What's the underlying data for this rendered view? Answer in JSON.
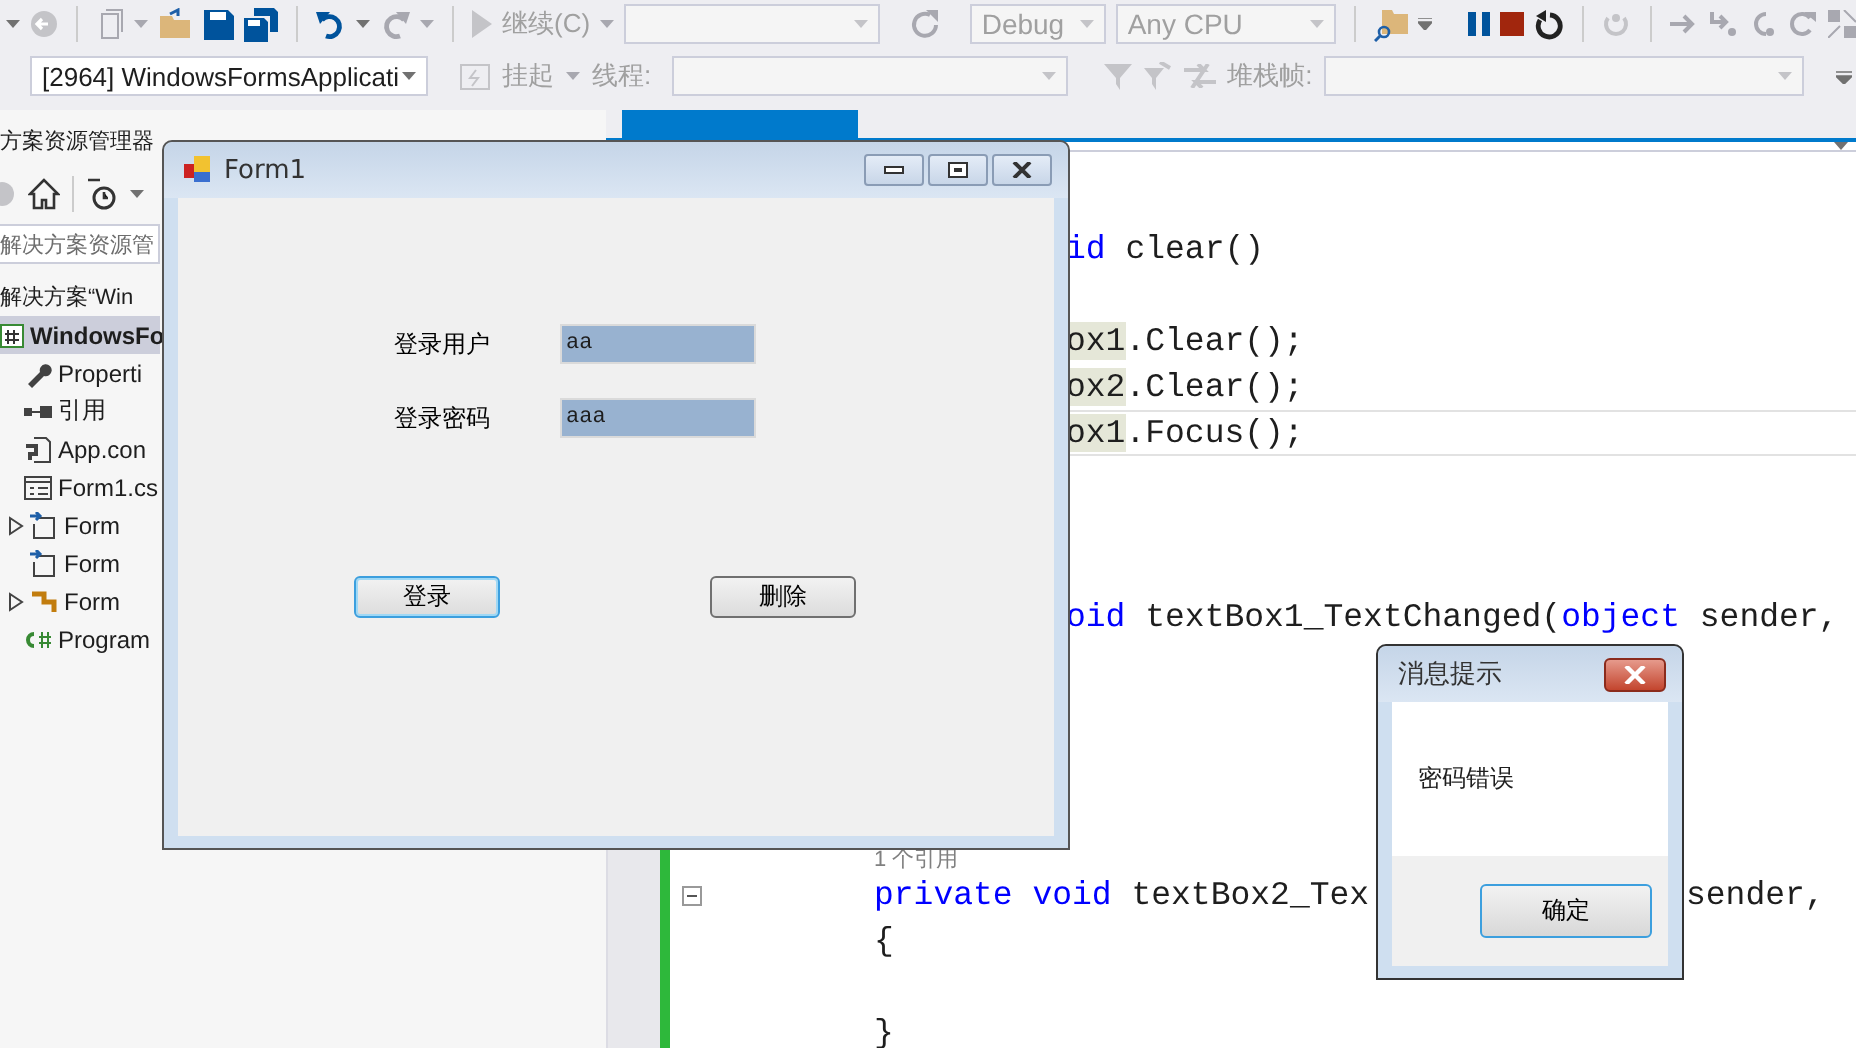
{
  "debug_toolbar": {
    "continue_label": "继续(C)",
    "configuration": "Debug",
    "platform": "Any CPU"
  },
  "debug_location": {
    "process": "[2964] WindowsFormsApplicati",
    "suspend_label": "挂起",
    "thread_label": "线程:",
    "stack_frame_label": "堆栈帧:"
  },
  "solution_explorer": {
    "title": "方案资源管理器",
    "search_placeholder": "解决方案资源管",
    "solution": "解决方案“Win",
    "tree": [
      {
        "label": "WindowsFo",
        "kind": "project",
        "selected": true,
        "children": [
          {
            "label": "Properti",
            "kind": "properties",
            "selected": false
          },
          {
            "label": "引用",
            "kind": "references",
            "selected": false
          },
          {
            "label": "App.con",
            "kind": "config",
            "selected": false
          },
          {
            "label": "Form1.cs",
            "kind": "form",
            "selected": false,
            "children": [
              {
                "label": "Form",
                "kind": "code",
                "selected": false,
                "expanded": false
              },
              {
                "label": "Form",
                "kind": "code",
                "selected": false
              },
              {
                "label": "Form",
                "kind": "resources",
                "selected": false,
                "expanded": false
              }
            ]
          },
          {
            "label": "Program",
            "kind": "csharp",
            "selected": false
          }
        ]
      }
    ]
  },
  "code_editor": {
    "lines": [
      {
        "kind": "clipped",
        "current": false,
        "tokens": [
          {
            "text": "id",
            "kind": "keyword",
            "highlighted": false
          },
          {
            "text": " clear()",
            "kind": "plain",
            "highlighted": false
          }
        ]
      },
      {
        "kind": "blank"
      },
      {
        "kind": "clipped",
        "current": false,
        "tokens": [
          {
            "text": "ox1",
            "kind": "plain",
            "highlighted": true
          },
          {
            "text": ".Clear();",
            "kind": "plain",
            "highlighted": false
          }
        ]
      },
      {
        "kind": "clipped",
        "current": false,
        "tokens": [
          {
            "text": "ox2",
            "kind": "plain",
            "highlighted": true
          },
          {
            "text": ".Clear();",
            "kind": "plain",
            "highlighted": false
          }
        ]
      },
      {
        "kind": "clipped",
        "current": true,
        "tokens": [
          {
            "text": "ox1",
            "kind": "plain",
            "highlighted": true
          },
          {
            "text": ".Focus();",
            "kind": "plain",
            "highlighted": false
          }
        ]
      },
      {
        "kind": "blank"
      },
      {
        "kind": "blank"
      },
      {
        "kind": "blank"
      },
      {
        "kind": "clipped",
        "current": false,
        "tokens": [
          {
            "text": "oid",
            "kind": "keyword",
            "highlighted": false
          },
          {
            "text": " textBox1_TextChanged(",
            "kind": "plain",
            "highlighted": false
          },
          {
            "text": "object",
            "kind": "keyword",
            "highlighted": false
          },
          {
            "text": " sender,",
            "kind": "plain",
            "highlighted": false
          }
        ]
      },
      {
        "kind": "blank"
      },
      {
        "kind": "blank"
      },
      {
        "kind": "blank"
      },
      {
        "kind": "blank"
      },
      {
        "kind": "lens",
        "text": "1 个引用"
      },
      {
        "kind": "code",
        "current": false,
        "expanded": true,
        "tokens": [
          {
            "text": "private",
            "kind": "keyword",
            "highlighted": false
          },
          {
            "text": " void",
            "kind": "keyword",
            "highlighted": false
          },
          {
            "text": " textBox2_Tex",
            "kind": "plain",
            "highlighted": false
          }
        ],
        "tail": "sender,"
      },
      {
        "kind": "code",
        "current": false,
        "tokens": [
          {
            "text": "{",
            "kind": "plain",
            "highlighted": false
          }
        ]
      },
      {
        "kind": "blank"
      },
      {
        "kind": "code",
        "current": false,
        "tokens": [
          {
            "text": "}",
            "kind": "plain",
            "highlighted": false
          }
        ]
      }
    ]
  },
  "form_window": {
    "title": "Form1",
    "fields": [
      {
        "label": "登录用户",
        "value": "aa"
      },
      {
        "label": "登录密码",
        "value": "aaa"
      }
    ],
    "buttons": [
      {
        "label": "登录",
        "focused": true
      },
      {
        "label": "删除",
        "focused": false
      }
    ]
  },
  "message_box": {
    "title": "消息提示",
    "message": "密码错误",
    "button": "确定"
  }
}
